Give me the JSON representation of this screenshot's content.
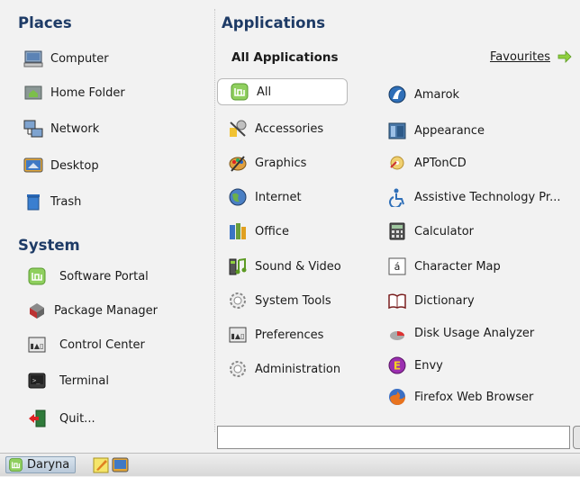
{
  "places": {
    "title": "Places",
    "items": [
      {
        "label": "Computer",
        "icon": "computer-icon"
      },
      {
        "label": "Home Folder",
        "icon": "home-folder-icon"
      },
      {
        "label": "Network",
        "icon": "network-icon"
      },
      {
        "label": "Desktop",
        "icon": "desktop-icon"
      },
      {
        "label": "Trash",
        "icon": "trash-icon"
      }
    ]
  },
  "system": {
    "title": "System",
    "items": [
      {
        "label": "Software Portal",
        "icon": "mint-logo-icon"
      },
      {
        "label": "Package Manager",
        "icon": "package-manager-icon"
      },
      {
        "label": "Control Center",
        "icon": "control-center-icon"
      },
      {
        "label": "Terminal",
        "icon": "terminal-icon"
      },
      {
        "label": "Quit...",
        "icon": "quit-icon"
      }
    ]
  },
  "applications": {
    "title": "Applications",
    "subtitle": "All Applications",
    "favourites_label": "Favourites",
    "categories": [
      {
        "label": "All",
        "icon": "mint-logo-icon",
        "selected": true
      },
      {
        "label": "Accessories",
        "icon": "accessories-icon"
      },
      {
        "label": "Graphics",
        "icon": "graphics-icon"
      },
      {
        "label": "Internet",
        "icon": "internet-globe-icon"
      },
      {
        "label": "Office",
        "icon": "office-icon"
      },
      {
        "label": "Sound & Video",
        "icon": "sound-video-icon"
      },
      {
        "label": "System Tools",
        "icon": "system-tools-icon"
      },
      {
        "label": "Preferences",
        "icon": "preferences-icon"
      },
      {
        "label": "Administration",
        "icon": "administration-icon"
      }
    ],
    "apps": [
      {
        "label": "Amarok",
        "icon": "amarok-icon"
      },
      {
        "label": "Appearance",
        "icon": "appearance-icon"
      },
      {
        "label": "APTonCD",
        "icon": "aptoncd-icon"
      },
      {
        "label": "Assistive Technology Pr...",
        "icon": "accessibility-icon"
      },
      {
        "label": "Calculator",
        "icon": "calculator-icon"
      },
      {
        "label": "Character Map",
        "icon": "character-map-icon"
      },
      {
        "label": "Dictionary",
        "icon": "dictionary-icon"
      },
      {
        "label": "Disk Usage Analyzer",
        "icon": "disk-usage-icon"
      },
      {
        "label": "Envy",
        "icon": "envy-icon"
      },
      {
        "label": "Firefox Web Browser",
        "icon": "firefox-icon"
      }
    ],
    "search": {
      "value": "",
      "placeholder": ""
    }
  },
  "panel": {
    "menu_button_label": "Daryna",
    "launchers": [
      {
        "icon": "text-editor-icon"
      },
      {
        "icon": "desktop-icon"
      }
    ]
  },
  "colors": {
    "heading": "#1e3b66",
    "mint_green": "#7cbf4a",
    "panel": "#dcdcdc"
  }
}
